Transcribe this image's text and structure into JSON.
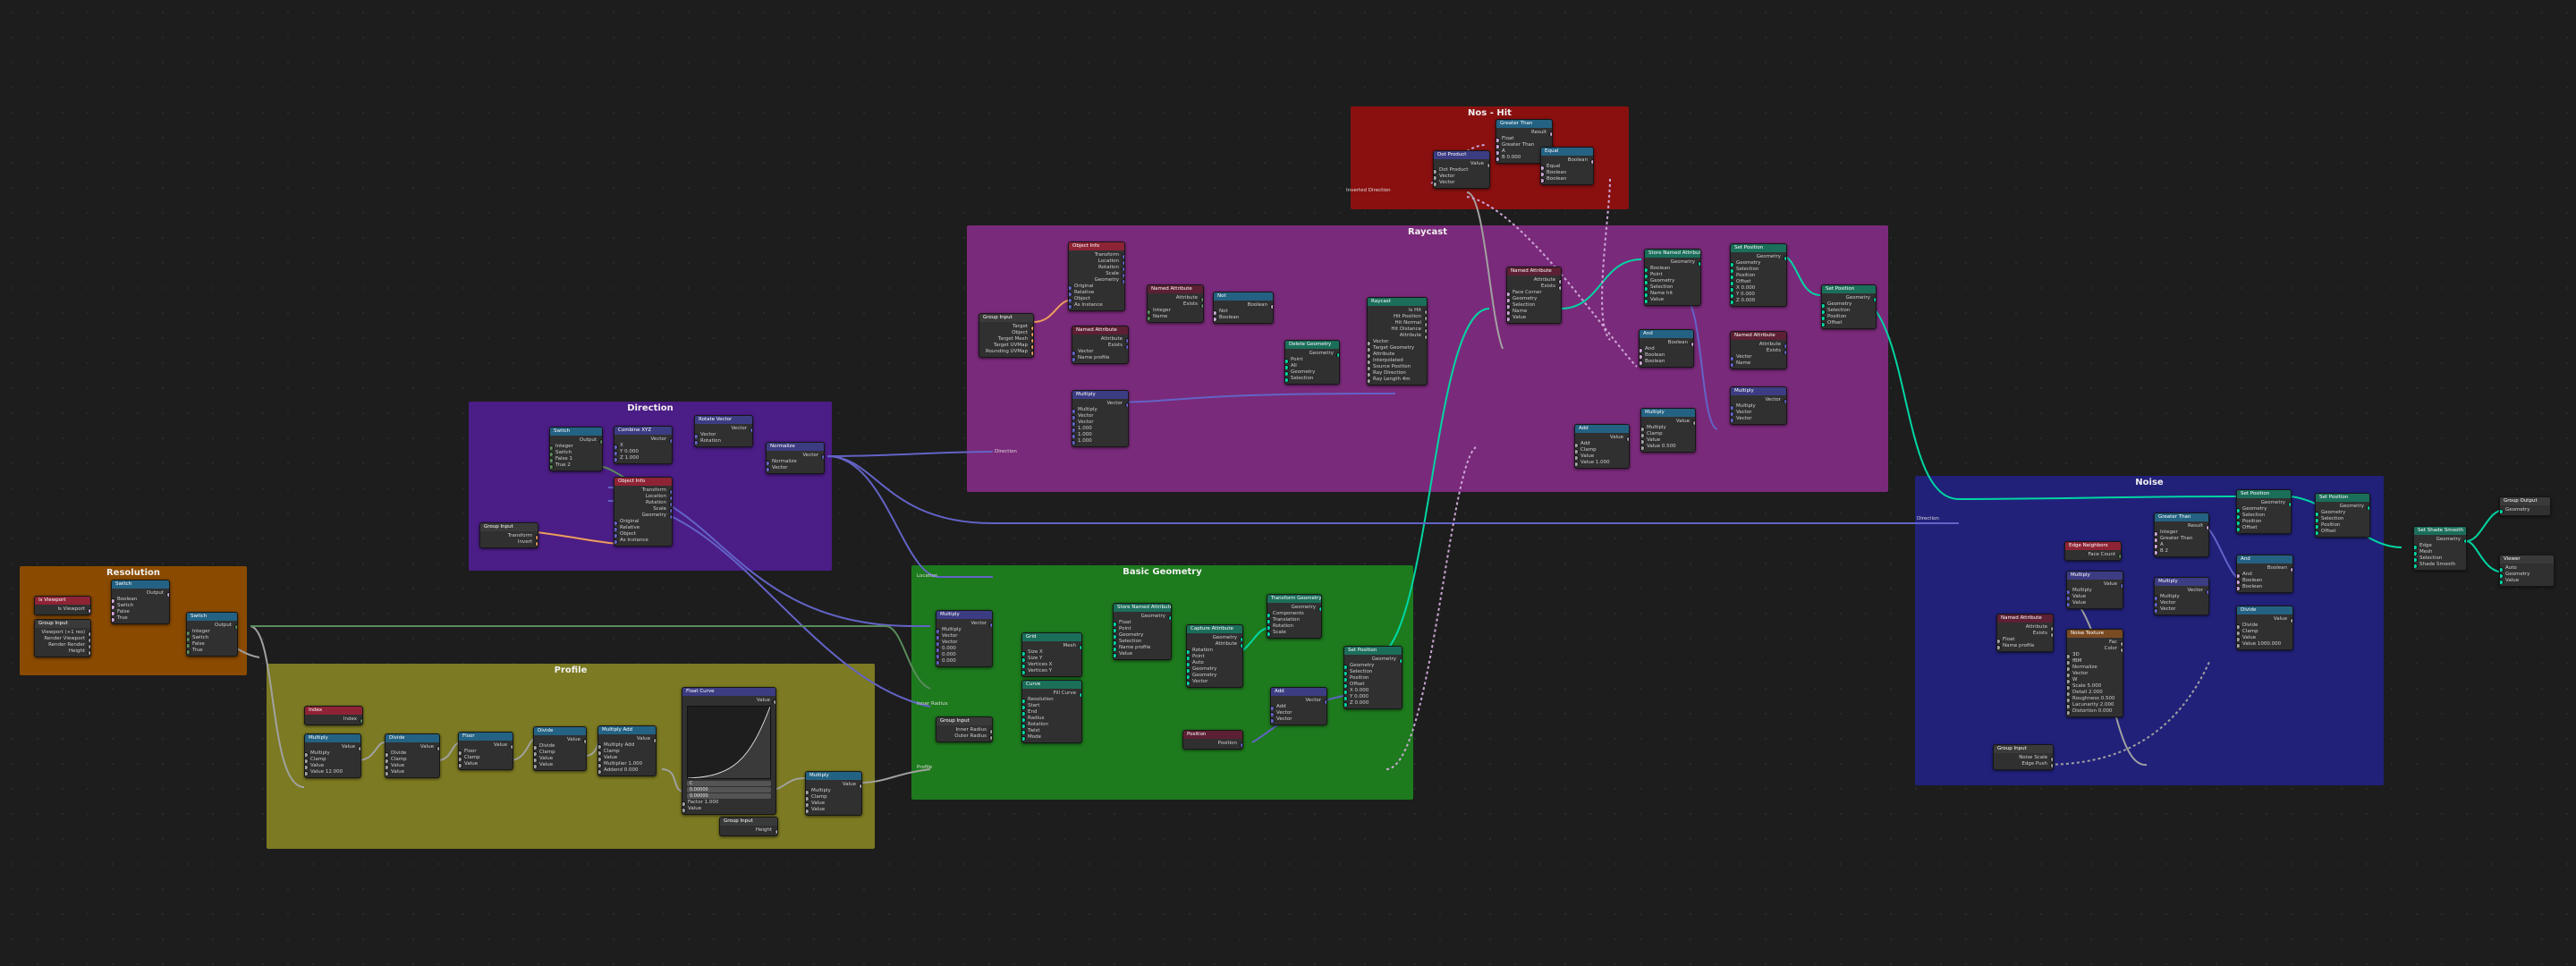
{
  "colors": {
    "frame_resolution": "#8a4a00",
    "frame_profile": "#7c7a22",
    "frame_direction": "#4b1d86",
    "frame_basic_geometry": "#1d7a1d",
    "frame_raycast": "#7a2a7a",
    "frame_nos_hit": "#8a1010",
    "frame_noise": "#21217a",
    "header_input": "#8e2335",
    "header_math": "#246283",
    "header_vector": "#3c3c83",
    "header_geometry": "#1b6e5a",
    "header_attribute": "#5c1f33",
    "header_texture": "#7a4a22",
    "header_output": "#3a3a3a",
    "wire_geometry": "#00d6a3",
    "wire_vector": "#6363c7",
    "wire_float": "#a1a1a1",
    "wire_int": "#598c5c",
    "wire_bool": "#cca6d6",
    "wire_object": "#ed9e5c"
  },
  "frames": {
    "resolution": "Resolution",
    "profile": "Profile",
    "direction": "Direction",
    "basic_geometry": "Basic Geometry",
    "raycast": "Raycast",
    "nos_hit": "Nos - Hit",
    "noise": "Noise"
  },
  "nodes": {
    "res_viewport": {
      "title": "Is Viewport",
      "rows": [
        "Is Viewport"
      ]
    },
    "res_group_input": {
      "title": "Group Input",
      "rows": [
        "Viewport (+1 res)",
        "Render Viewport",
        "Render Render",
        "Height"
      ]
    },
    "res_switch1": {
      "title": "Switch",
      "rows": [
        "Output",
        "Boolean",
        "Switch",
        "False",
        "True"
      ]
    },
    "res_switch2": {
      "title": "Switch",
      "rows": [
        "Output",
        "Integer",
        "Switch",
        "False",
        "True"
      ]
    },
    "prof_index": {
      "title": "Index",
      "rows": [
        "Index"
      ]
    },
    "prof_multiply": {
      "title": "Multiply",
      "rows": [
        "Value",
        "Multiply",
        "Clamp",
        "Value",
        "Value 12.000"
      ]
    },
    "prof_divide1": {
      "title": "Divide",
      "rows": [
        "Value",
        "Divide",
        "Clamp",
        "Value",
        "Value"
      ]
    },
    "prof_floor": {
      "title": "Floor",
      "rows": [
        "Value",
        "Floor",
        "Clamp",
        "Value"
      ]
    },
    "prof_divide2": {
      "title": "Divide",
      "rows": [
        "Value",
        "Divide",
        "Clamp",
        "Value",
        "Value"
      ]
    },
    "prof_multiply_add": {
      "title": "Multiply Add",
      "rows": [
        "Value",
        "Multiply Add",
        "Clamp",
        "Value",
        "Multiplier 1.000",
        "Addend 0.000"
      ]
    },
    "prof_float_curve": {
      "title": "Float Curve",
      "rows": [
        "Value",
        "Factor 1.000",
        "Value"
      ],
      "fields": [
        "C",
        "0.00000",
        "0.00000"
      ]
    },
    "prof_multiply2": {
      "title": "Multiply",
      "rows": [
        "Value",
        "Multiply",
        "Clamp",
        "Value",
        "Value"
      ]
    },
    "prof_group_input": {
      "title": "Group Input",
      "rows": [
        "Height"
      ]
    },
    "dir_switch": {
      "title": "Switch",
      "rows": [
        "Output",
        "Integer",
        "Switch",
        "False 1",
        "True 2"
      ]
    },
    "dir_combine": {
      "title": "Combine XYZ",
      "rows": [
        "Vector",
        "X",
        "Y 0.000",
        "Z 1.000"
      ]
    },
    "dir_object_info": {
      "title": "Object Info",
      "rows": [
        "Transform",
        "Location",
        "Rotation",
        "Scale",
        "Geometry",
        "Original",
        "Relative",
        "Object",
        "As Instance"
      ]
    },
    "dir_rotate_vector": {
      "title": "Rotate Vector",
      "rows": [
        "Vector",
        "Vector",
        "Rotation"
      ]
    },
    "dir_normalize": {
      "title": "Normalize",
      "rows": [
        "Vector",
        "Normalize",
        "Vector"
      ]
    },
    "dir_group_input": {
      "title": "Group Input",
      "rows": [
        "Transform",
        "Invert"
      ]
    },
    "bg_multiply": {
      "title": "Multiply",
      "rows": [
        "Vector",
        "Multiply",
        "Vector",
        "Vector",
        "0.000",
        "0.000",
        "0.000"
      ]
    },
    "bg_group_input": {
      "title": "Group Input",
      "rows": [
        "Inner Radius",
        "Outer Radius"
      ]
    },
    "bg_grid": {
      "title": "Grid",
      "rows": [
        "Mesh",
        "Size X",
        "Size Y",
        "Vertices X",
        "Vertices Y"
      ]
    },
    "bg_curve": {
      "title": "Curve",
      "rows": [
        "Fill Curve",
        "Resolution",
        "Start",
        "End",
        "Radius",
        "Rotation",
        "Twist",
        "Mode"
      ]
    },
    "bg_store_attr": {
      "title": "Store Named Attribute",
      "rows": [
        "Geometry",
        "Float",
        "Point",
        "Geometry",
        "Selection",
        "Name profile",
        "Value"
      ]
    },
    "bg_capture": {
      "title": "Capture Attribute",
      "rows": [
        "Geometry",
        "Attribute",
        "Rotation",
        "Point",
        "Auto",
        "Geometry",
        "Geometry",
        "Vector"
      ]
    },
    "bg_transform": {
      "title": "Transform Geometry",
      "rows": [
        "Geometry",
        "Components",
        "Translation",
        "Rotation",
        "Scale"
      ]
    },
    "bg_set_position": {
      "title": "Set Position",
      "rows": [
        "Geometry",
        "Geometry",
        "Selection",
        "Position",
        "Offset",
        "X 0.000",
        "Y 0.000",
        "Z 0.000"
      ]
    },
    "bg_position": {
      "title": "Position",
      "rows": [
        "Position"
      ]
    },
    "bg_add": {
      "title": "Add",
      "rows": [
        "Vector",
        "Add",
        "Vector",
        "Vector"
      ]
    },
    "rc_object_info": {
      "title": "Object Info",
      "rows": [
        "Transform",
        "Location",
        "Rotation",
        "Scale",
        "Geometry",
        "Original",
        "Relative",
        "Object",
        "As Instance"
      ]
    },
    "rc_group_input": {
      "title": "Group Input",
      "rows": [
        "Target",
        "Object",
        "Target Mesh",
        "Target UVMap",
        "Rounding UVMap"
      ]
    },
    "rc_named_attr1": {
      "title": "Named Attribute",
      "rows": [
        "Attribute",
        "Exists",
        "Vector",
        "Name profile"
      ]
    },
    "rc_named_attr2": {
      "title": "Named Attribute",
      "rows": [
        "Attribute",
        "Exists",
        "Integer",
        "Name"
      ]
    },
    "rc_named_attr3": {
      "title": "Named Attribute",
      "rows": [
        "Attribute",
        "Exists",
        "Vector",
        "Name"
      ]
    },
    "rc_not": {
      "title": "Not",
      "rows": [
        "Boolean",
        "Not",
        "Boolean"
      ]
    },
    "rc_multiply": {
      "title": "Multiply",
      "rows": [
        "Vector",
        "Multiply",
        "Vector",
        "Vector",
        "1.000",
        "1.000",
        "1.000"
      ]
    },
    "rc_delete_geom": {
      "title": "Delete Geometry",
      "rows": [
        "Geometry",
        "Point",
        "All",
        "Geometry",
        "Selection"
      ]
    },
    "rc_raycast": {
      "title": "Raycast",
      "rows": [
        "Is Hit",
        "Hit Position",
        "Hit Normal",
        "Hit Distance",
        "Attribute",
        "Vector",
        "Target Geometry",
        "Attribute",
        "Interpolated",
        "Source Position",
        "Ray Direction",
        "Ray Length 4m"
      ]
    },
    "rc_named_attr4": {
      "title": "Named Attribute",
      "rows": [
        "Attribute",
        "Exists",
        "Face Corner",
        "Geometry",
        "Selection",
        "Name",
        "Value"
      ]
    },
    "rc_store1": {
      "title": "Store Named Attribute",
      "rows": [
        "Geometry",
        "Boolean",
        "Point",
        "Geometry",
        "Selection",
        "Name hit",
        "Value"
      ]
    },
    "rc_set_position1": {
      "title": "Set Position",
      "rows": [
        "Geometry",
        "Geometry",
        "Selection",
        "Position",
        "Offset",
        "X 0.000",
        "Y 0.000",
        "Z 0.000"
      ]
    },
    "rc_set_position2": {
      "title": "Set Position",
      "rows": [
        "Geometry",
        "Geometry",
        "Selection",
        "Position",
        "Offset"
      ]
    },
    "rc_and": {
      "title": "And",
      "rows": [
        "Boolean",
        "And",
        "Boolean",
        "Boolean"
      ]
    },
    "rc_named_attr5": {
      "title": "Named Attribute",
      "rows": [
        "Attribute",
        "Exists",
        "Vector",
        "Name"
      ]
    },
    "rc_multiply2": {
      "title": "Multiply",
      "rows": [
        "Vector",
        "Multiply",
        "Vector",
        "Vector"
      ]
    },
    "rc_add": {
      "title": "Add",
      "rows": [
        "Value",
        "Add",
        "Clamp",
        "Value",
        "Value 1.000"
      ]
    },
    "rc_multiply3": {
      "title": "Multiply",
      "rows": [
        "Value",
        "Multiply",
        "Clamp",
        "Value",
        "Value 0.500"
      ]
    },
    "nh_greater": {
      "title": "Greater Than",
      "rows": [
        "Result",
        "Float",
        "Greater Than",
        "A",
        "B 0.000"
      ]
    },
    "nh_dot": {
      "title": "Dot Product",
      "rows": [
        "Value",
        "Dot Product",
        "Vector",
        "Vector"
      ]
    },
    "nh_equal": {
      "title": "Equal",
      "rows": [
        "Boolean",
        "Equal",
        "Boolean",
        "Boolean"
      ]
    },
    "nz_edge_neighbors": {
      "title": "Edge Neighbors",
      "rows": [
        "Face Count"
      ]
    },
    "nz_multiply": {
      "title": "Multiply",
      "rows": [
        "Value",
        "Multiply",
        "Value",
        "Value"
      ]
    },
    "nz_named_attr": {
      "title": "Named Attribute",
      "rows": [
        "Attribute",
        "Exists",
        "Float",
        "Name profile"
      ]
    },
    "nz_noise": {
      "title": "Noise Texture",
      "rows": [
        "Fac",
        "Color",
        "3D",
        "fBM",
        "Normalize",
        "Vector",
        "W",
        "Scale 5.000",
        "Detail 2.000",
        "Roughness 0.500",
        "Lacunarity 2.000",
        "Distortion 0.000"
      ]
    },
    "nz_group_input": {
      "title": "Group Input",
      "rows": [
        "Noise Scale",
        "Edge Push"
      ]
    },
    "nz_greater": {
      "title": "Greater Than",
      "rows": [
        "Result",
        "Integer",
        "Greater Than",
        "A",
        "B 2"
      ]
    },
    "nz_multiply2": {
      "title": "Multiply",
      "rows": [
        "Vector",
        "Multiply",
        "Vector",
        "Vector"
      ]
    },
    "nz_and": {
      "title": "And",
      "rows": [
        "Boolean",
        "And",
        "Boolean",
        "Boolean"
      ]
    },
    "nz_divide": {
      "title": "Divide",
      "rows": [
        "Value",
        "Divide",
        "Clamp",
        "Value",
        "Value 1000.000"
      ]
    },
    "nz_set_position1": {
      "title": "Set Position",
      "rows": [
        "Geometry",
        "Geometry",
        "Selection",
        "Position",
        "Offset"
      ]
    },
    "nz_set_position2": {
      "title": "Set Position",
      "rows": [
        "Geometry",
        "Geometry",
        "Selection",
        "Position",
        "Offset"
      ]
    },
    "out_shade_smooth": {
      "title": "Set Shade Smooth",
      "rows": [
        "Geometry",
        "Edge",
        "Mesh",
        "Selection",
        "Shade Smooth"
      ]
    },
    "out_group_output": {
      "title": "Group Output",
      "rows": [
        "Geometry"
      ]
    },
    "out_viewer": {
      "title": "Viewer",
      "rows": [
        "Auto",
        "Geometry",
        "Value"
      ]
    }
  },
  "reroute_labels": {
    "direction": "Direction",
    "inverted_direction": "Inverted Direction",
    "location": "Location",
    "inner_radius": "Inner Radius",
    "profile": "Profile",
    "direction2": "Direction"
  }
}
